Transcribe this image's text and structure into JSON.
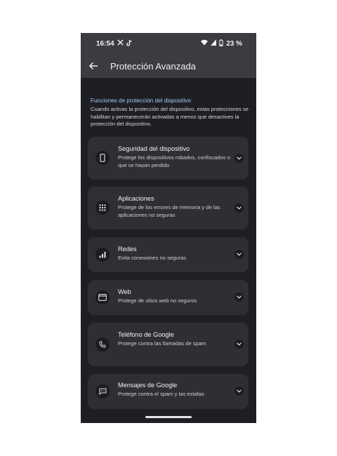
{
  "status": {
    "time": "16:54",
    "battery": "23 %",
    "left_icons": [
      "x-icon",
      "tiktok-icon"
    ],
    "right_icons": [
      "wifi-icon",
      "signal-icon",
      "battery-icon"
    ]
  },
  "appbar": {
    "title": "Protección Avanzada"
  },
  "section": {
    "title": "Funciones de protección del dispositivo",
    "description": "Cuando activas la protección del dispositivo, estas protecciones se habilitan y permanecerán activadas a menos que desactives la protección del dispositivo."
  },
  "cards": [
    {
      "title": "Seguridad del dispositivo",
      "subtitle": "Protege los dispositivos robados, confiscados o que se hayan perdido",
      "icon": "phone-icon"
    },
    {
      "title": "Aplicaciones",
      "subtitle": "Protege de los errores de memoria y de las aplicaciones no seguras",
      "icon": "apps-grid-icon"
    },
    {
      "title": "Redes",
      "subtitle": "Evita conexiones no seguras",
      "icon": "signal-bars-icon"
    },
    {
      "title": "Web",
      "subtitle": "Protege de sitios web no seguros",
      "icon": "browser-window-icon"
    },
    {
      "title": "Teléfono de Google",
      "subtitle": "Protege contra las llamadas de spam",
      "icon": "call-icon"
    },
    {
      "title": "Mensajes de Google",
      "subtitle": "Protege contra el spam y las estafas",
      "icon": "message-icon"
    }
  ],
  "colors": {
    "background": "#1d1f22",
    "appbar": "#3a3c3f",
    "card": "#2d2f33",
    "accent": "#a8c7fa"
  }
}
